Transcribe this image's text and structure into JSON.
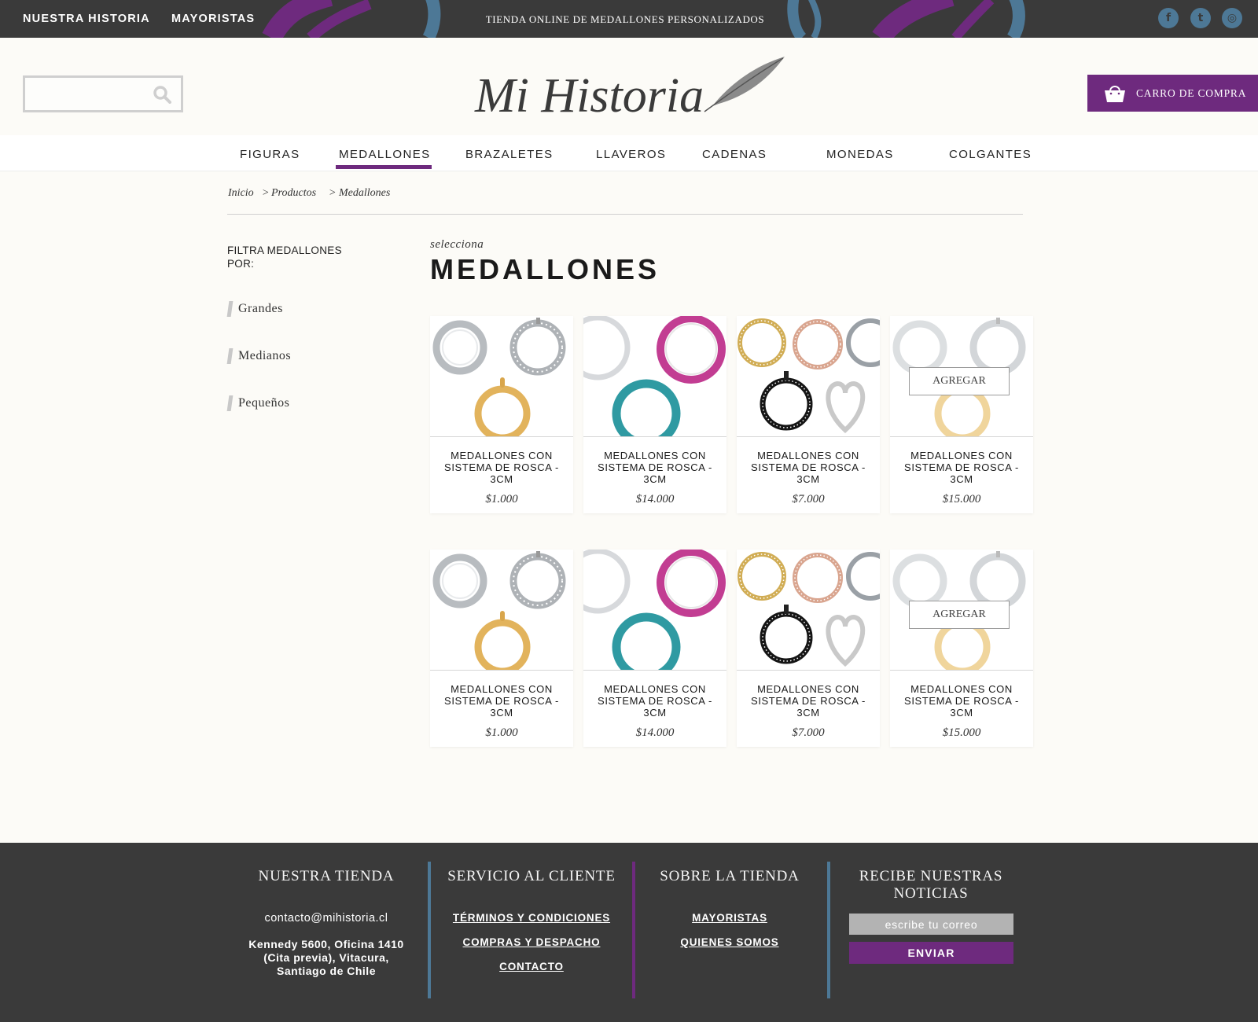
{
  "topbar": {
    "links": [
      "NUESTRA HISTORIA",
      "MAYORISTAS"
    ],
    "tagline": "TIENDA ONLINE DE MEDALLONES PERSONALIZADOS",
    "social": [
      {
        "icon": "facebook-icon",
        "glyph": "f"
      },
      {
        "icon": "twitter-icon",
        "glyph": "t"
      },
      {
        "icon": "instagram-icon",
        "glyph": "◎"
      }
    ]
  },
  "header": {
    "search": {
      "placeholder": "",
      "value": "",
      "icon": "search-icon"
    },
    "logo": {
      "text": "Mi Historia",
      "icon": "feather-icon"
    },
    "cart": {
      "label": "CARRO DE COMPRA",
      "icon": "shopping-bag-icon"
    }
  },
  "nav": {
    "items": [
      "FIGURAS",
      "MEDALLONES",
      "BRAZALETES",
      "LLAVEROS",
      "CADENAS",
      "MONEDAS",
      "COLGANTES"
    ],
    "active": "MEDALLONES"
  },
  "breadcrumb": {
    "items": [
      "Inicio",
      ">",
      "Productos",
      ">",
      "Medallones"
    ]
  },
  "sidebar": {
    "title": "FILTRA MEDALLONES POR:",
    "filters": [
      "Grandes",
      "Medianos",
      "Pequeños"
    ]
  },
  "main": {
    "subtitle": "selecciona",
    "title": "MEDALLONES",
    "add_label": "AGREGAR",
    "products": [
      {
        "title": "MEDALLONES CON SISTEMA DE ROSCA - 3CM",
        "price": "$1.000",
        "image": "silver-gold-lockets"
      },
      {
        "title": "MEDALLONES CON SISTEMA DE ROSCA - 3CM",
        "price": "$14.000",
        "image": "colored-ring-lockets"
      },
      {
        "title": "MEDALLONES CON SISTEMA DE ROSCA - 3CM",
        "price": "$7.000",
        "image": "crystal-heart-lockets"
      },
      {
        "title": "MEDALLONES CON SISTEMA DE ROSCA - 3CM",
        "price": "$15.000",
        "image": "silver-gold-lockets",
        "hover": true
      },
      {
        "title": "MEDALLONES CON SISTEMA DE ROSCA - 3CM",
        "price": "$1.000",
        "image": "silver-gold-lockets"
      },
      {
        "title": "MEDALLONES CON SISTEMA DE ROSCA - 3CM",
        "price": "$14.000",
        "image": "colored-ring-lockets"
      },
      {
        "title": "MEDALLONES CON SISTEMA DE ROSCA - 3CM",
        "price": "$7.000",
        "image": "crystal-heart-lockets"
      },
      {
        "title": "MEDALLONES CON SISTEMA DE ROSCA - 3CM",
        "price": "$15.000",
        "image": "silver-gold-lockets",
        "hover": true
      }
    ]
  },
  "footer": {
    "store": {
      "title": "NUESTRA TIENDA",
      "email": "contacto@mihistoria.cl",
      "address_lines": [
        "Kennedy 5600, Oficina 1410",
        "(Cita previa), Vitacura,",
        "Santiago de Chile"
      ]
    },
    "service": {
      "title": "SERVICIO AL CLIENTE",
      "links": [
        "TÉRMINOS Y CONDICIONES",
        "COMPRAS Y DESPACHO",
        "CONTACTO"
      ]
    },
    "about": {
      "title": "SOBRE LA TIENDA",
      "links": [
        "MAYORISTAS",
        "QUIENES SOMOS"
      ]
    },
    "newsletter": {
      "title_lines": [
        "RECIBE NUESTRAS",
        "NOTICIAS"
      ],
      "placeholder": "escribe tu correo",
      "button": "ENVIAR"
    }
  },
  "colors": {
    "purple": "#6e2a7e",
    "blue": "#4d7896",
    "dark": "#3a3a3a",
    "background": "#fcfbf7"
  }
}
